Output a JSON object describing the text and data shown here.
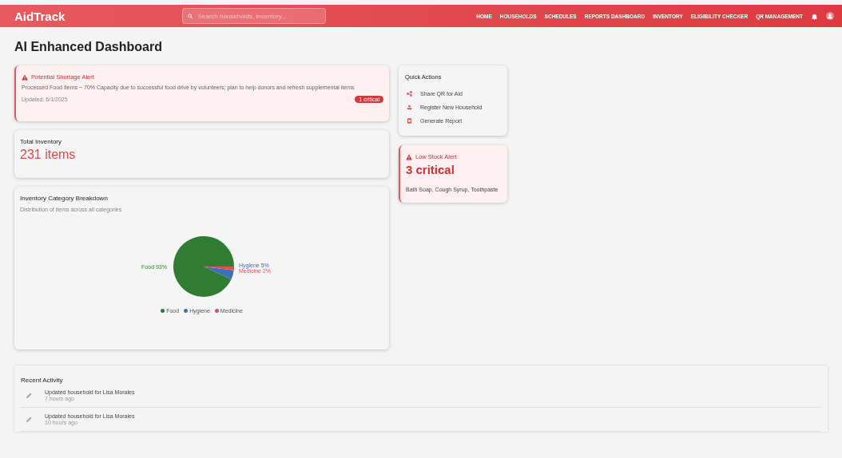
{
  "navbar": {
    "brand": "AidTrack",
    "search": {
      "placeholder": "Search households, inventory..."
    },
    "links": [
      "HOME",
      "HOUSEHOLDS",
      "SCHEDULES",
      "REPORTS DASHBOARD",
      "INVENTORY",
      "ELIGIBILITY CHECKER",
      "QR MANAGEMENT"
    ]
  },
  "page_title": "AI Enhanced Dashboard",
  "shortage_alert": {
    "title": "Potential Shortage Alert",
    "message": "Processed Food Items ~ 70% Capacity due to successful food drive by volunteers; plan to help donors and refresh supplemental items",
    "updated": "Updated: 6/1/2025",
    "badge": "1 critical"
  },
  "total_inventory": {
    "label": "Total Inventory",
    "value": "231 items"
  },
  "category_breakdown": {
    "title": "Inventory Category Breakdown",
    "subtitle": "Distribution of items across all categories",
    "chart_data": {
      "type": "pie",
      "categories": [
        "Food",
        "Hygiene",
        "Medicine"
      ],
      "values": [
        93,
        5,
        2
      ],
      "colors": [
        "#2e7d32",
        "#3f6fb5",
        "#e04e5c"
      ],
      "value_labels": [
        "Food 93%",
        "Hygiene 5%",
        "Medicine 2%"
      ]
    }
  },
  "quick_actions": {
    "title": "Quick Actions",
    "items": [
      {
        "kind": "share",
        "label": "Share QR for Aid"
      },
      {
        "kind": "register",
        "label": "Register New Household"
      },
      {
        "kind": "report",
        "label": "Generate Report"
      }
    ]
  },
  "low_stock_alert": {
    "title": "Low Stock Alert",
    "value": "3 critical",
    "items": "Bath Soap, Cough Syrup, Toothpaste"
  },
  "recent_activity": {
    "title": "Recent Activity",
    "items": [
      {
        "text": "Updated household for Lisa Morales",
        "time": "7 hours ago"
      },
      {
        "text": "Updated household for Lisa Morales",
        "time": "10 hours ago"
      }
    ]
  }
}
